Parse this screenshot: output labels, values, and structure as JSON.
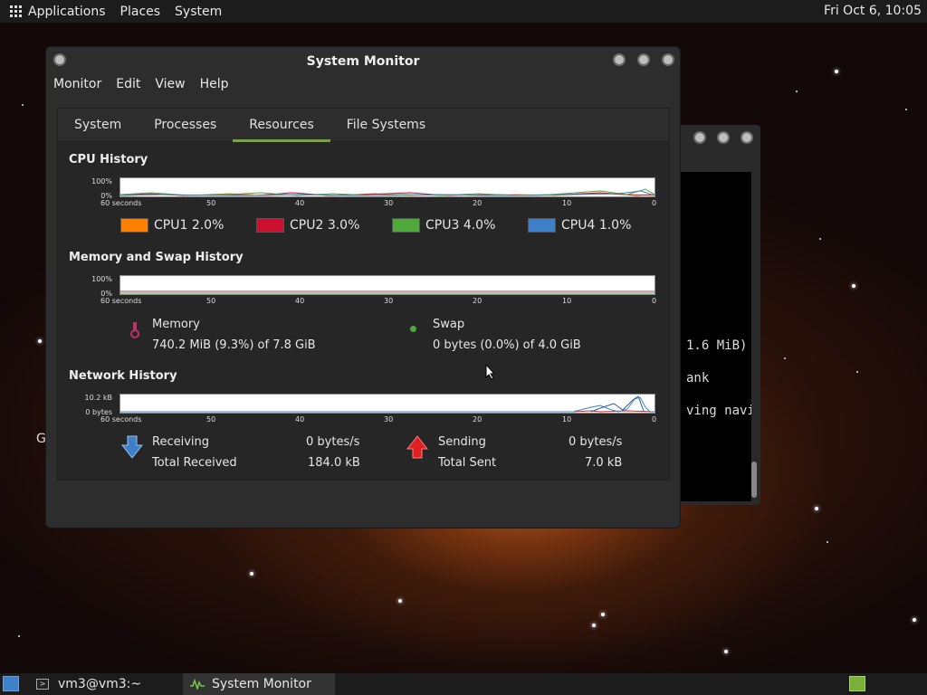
{
  "top_panel": {
    "menus": [
      "Applications",
      "Places",
      "System"
    ],
    "clock": "Fri Oct  6, 10:05"
  },
  "terminal_window": {
    "lines": [
      " 1.6 MiB)",
      "ank",
      "ving navig"
    ]
  },
  "desktop_letter": "G",
  "window": {
    "title": "System Monitor",
    "menubar": [
      "Monitor",
      "Edit",
      "View",
      "Help"
    ],
    "tabs": [
      "System",
      "Processes",
      "Resources",
      "File Systems"
    ],
    "active_tab": "Resources"
  },
  "cpu": {
    "heading": "CPU History",
    "y_top": "100%",
    "y_bottom": "0%",
    "legend": [
      {
        "label": "CPU1",
        "value": "2.0%",
        "color": "#ff7f00"
      },
      {
        "label": "CPU2",
        "value": "3.0%",
        "color": "#cc0f2e"
      },
      {
        "label": "CPU3",
        "value": "4.0%",
        "color": "#4ea93a"
      },
      {
        "label": "CPU4",
        "value": "1.0%",
        "color": "#3d80c8"
      }
    ]
  },
  "memory": {
    "heading": "Memory and Swap History",
    "y_top": "100%",
    "y_bottom": "0%",
    "memory_label": "Memory",
    "memory_value": "740.2 MiB (9.3%) of 7.8 GiB",
    "swap_label": "Swap",
    "swap_value": "0 bytes (0.0%) of 4.0 GiB",
    "memory_color": "#c0306a",
    "swap_color": "#4ea93a"
  },
  "network": {
    "heading": "Network History",
    "y_top": "10.2 kB",
    "y_bottom": "0 bytes",
    "receiving_label": "Receiving",
    "receiving_value": "0 bytes/s",
    "total_received_label": "Total Received",
    "total_received_value": "184.0 kB",
    "sending_label": "Sending",
    "sending_value": "0 bytes/s",
    "total_sent_label": "Total Sent",
    "total_sent_value": "7.0 kB",
    "receive_color": "#3d80c8",
    "send_color": "#e02020"
  },
  "x_axis_labels": [
    "60 seconds",
    "50",
    "40",
    "30",
    "20",
    "10",
    "0"
  ],
  "bottom_panel": {
    "tasks": [
      "vm3@vm3:~",
      "System Monitor"
    ]
  }
}
